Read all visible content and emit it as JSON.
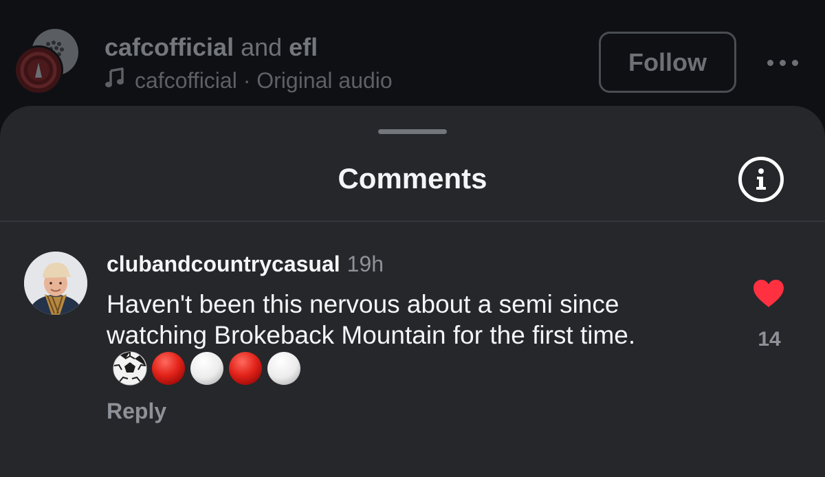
{
  "post": {
    "title_user1": "cafcofficial",
    "title_and": " and ",
    "title_user2": "efl",
    "audio_user": "cafcofficial",
    "audio_sep": " · ",
    "audio_label": "Original audio",
    "follow_label": "Follow"
  },
  "comments_sheet": {
    "title": "Comments",
    "comment": {
      "username": "clubandcountrycasual",
      "time": "19h",
      "text": "Haven't been this nervous about a semi since watching Brokeback Mountain for the first time.",
      "emojis": [
        "soccer-ball",
        "red-circle",
        "white-circle",
        "red-circle",
        "white-circle"
      ],
      "reply_label": "Reply",
      "like_count": "14"
    }
  },
  "colors": {
    "background": "#0e1013",
    "sheet": "#25272b",
    "like_red": "#ff3040",
    "muted_text": "#8e9197"
  }
}
